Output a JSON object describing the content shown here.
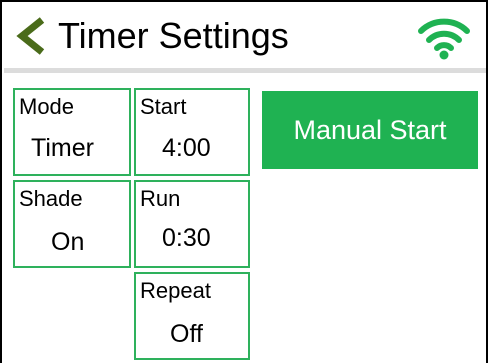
{
  "header": {
    "title": "Timer Settings",
    "back_icon": "chevron-left-icon",
    "wifi_icon": "wifi-icon"
  },
  "tiles": {
    "mode": {
      "label": "Mode",
      "value": "Timer"
    },
    "start": {
      "label": "Start",
      "value": "4:00"
    },
    "shade": {
      "label": "Shade",
      "value": "On"
    },
    "run": {
      "label": "Run",
      "value": "0:30"
    },
    "repeat": {
      "label": "Repeat",
      "value": "Off"
    }
  },
  "manual_button": {
    "label": "Manual Start"
  },
  "colors": {
    "accent": "#1fb252",
    "tile_border": "#2eb15c",
    "back_icon": "#4a6b1a",
    "divider": "#dcdcdc"
  }
}
